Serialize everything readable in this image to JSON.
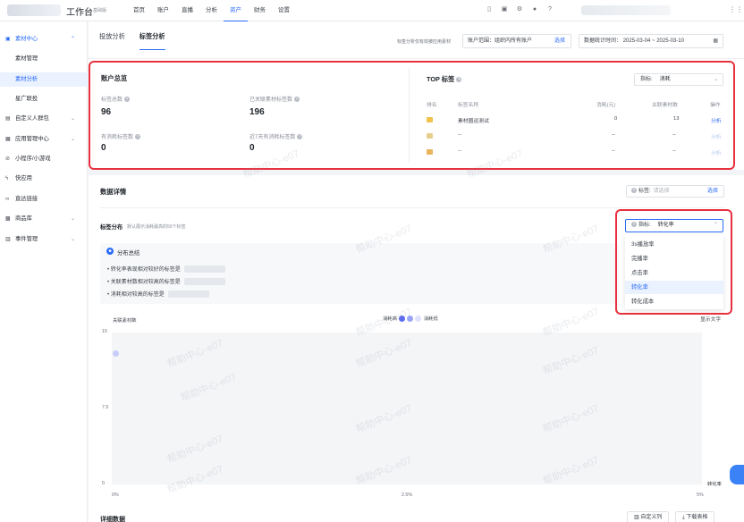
{
  "topbar": {
    "title": "工作台",
    "badge": "基础版",
    "nav": [
      "首页",
      "账户",
      "直播",
      "分析",
      "资产",
      "财务",
      "设置"
    ],
    "active_nav": "资产"
  },
  "sidebar": {
    "items": [
      {
        "label": "素材中心",
        "icon": "material-center-icon",
        "expanded": true
      },
      {
        "label": "素材管理",
        "sub": true
      },
      {
        "label": "素材分析",
        "sub": true,
        "active": true
      },
      {
        "label": "星广联投",
        "sub": true
      },
      {
        "label": "自定义人群包",
        "icon": "audience-pack-icon"
      },
      {
        "label": "应用管理中心",
        "icon": "app-center-icon"
      },
      {
        "label": "小程序/小游戏",
        "icon": "mini-program-icon"
      },
      {
        "label": "快应用",
        "icon": "quick-app-icon"
      },
      {
        "label": "直达链接",
        "icon": "deep-link-icon"
      },
      {
        "label": "商品库",
        "icon": "product-library-icon"
      },
      {
        "label": "事件管理",
        "icon": "event-management-icon"
      }
    ]
  },
  "page": {
    "tabs": [
      "投放分析",
      "标签分析"
    ],
    "active_tab": "标签分析",
    "filter_note": "标签分析仅有效被应用素材",
    "account_scope_label": "账户范围：",
    "account_scope_value": "组织内所有账户",
    "select_label": "选择",
    "date_label": "数据统计时间：",
    "date_value": "2025-03-04 ~ 2025-03-10"
  },
  "overview": {
    "title": "账户总览",
    "metrics": [
      {
        "label": "标签总数",
        "value": "96"
      },
      {
        "label": "已关联素材标签数",
        "value": "196"
      },
      {
        "label": "有消耗标签数",
        "value": "0"
      },
      {
        "label": "近7天有消耗标签数",
        "value": "0"
      }
    ]
  },
  "top_tags": {
    "title": "TOP 标签",
    "indicator_label": "指标:",
    "indicator_value": "消耗",
    "columns": [
      "排名",
      "标签名称",
      "消耗(元)",
      "关联素材数",
      "操作"
    ],
    "rows": [
      {
        "name": "素材圈运测试",
        "spend": "0",
        "count": "13",
        "action": "分析"
      },
      {
        "name": "--",
        "spend": "--",
        "count": "--",
        "action": "分析"
      },
      {
        "name": "--",
        "spend": "--",
        "count": "--",
        "action": "分析"
      }
    ]
  },
  "details": {
    "title": "数据详情",
    "tag_filter_label": "标签:",
    "tag_filter_placeholder": "请选择",
    "tag_filter_select": "选择",
    "dist_label": "标签分布",
    "dist_note": "默认展示消耗最高的50个标签",
    "summary_title": "分布总结",
    "summary_items": [
      "转化率表现相对较好的标签是",
      "关联素材数相对较高的标签是",
      "消耗相对较高的标签是"
    ],
    "indicator_label": "指标:",
    "indicator_value": "转化率",
    "dropdown_options": [
      "3s播放率",
      "完播率",
      "点击率",
      "转化率",
      "转化成本"
    ],
    "dropdown_active": "转化率",
    "show_text": "显示文字",
    "legend_high": "消耗高",
    "legend_low": "消耗低"
  },
  "chart_data": {
    "type": "scatter",
    "title": "",
    "ylabel": "关联素材数",
    "xlabel": "转化率",
    "x_ticks": [
      "0%",
      "2.5%",
      "5%"
    ],
    "y_ticks": [
      "0",
      "7.5",
      "15"
    ],
    "xlim": [
      0,
      5
    ],
    "ylim": [
      0,
      15
    ],
    "points": [
      {
        "x": 0,
        "y": 13
      }
    ],
    "colors": {
      "high": "#5b6cf0",
      "mid": "#9aa4f5",
      "low": "#dfe3fb"
    }
  },
  "bottom": {
    "title": "详细数据",
    "custom_columns": "自定义列",
    "download_table": "下载表格"
  },
  "watermark": "帮助中心-e07"
}
